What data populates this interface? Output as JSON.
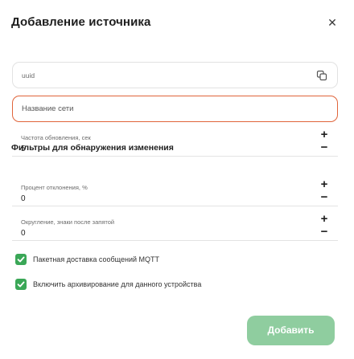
{
  "dialog": {
    "title": "Добавление источника",
    "close_icon": "close-icon"
  },
  "uuid_field": {
    "placeholder": "uuid",
    "copy_icon": "copy-icon"
  },
  "network_name_field": {
    "placeholder": "Название сети",
    "border_color": "#e0643a"
  },
  "update_frequency": {
    "label": "Частота обновления, сек",
    "value": "5",
    "plus": "+",
    "minus": "−"
  },
  "filters_section": {
    "title": "Фильтры для обнаружения изменения"
  },
  "deviation_percent": {
    "label": "Процент отклонения, %",
    "value": "0",
    "plus": "+",
    "minus": "−"
  },
  "rounding": {
    "label": "Округление, знаки после запятой",
    "value": "0",
    "plus": "+",
    "minus": "−"
  },
  "checkboxes": [
    {
      "label": "Пакетная доставка сообщений MQTT",
      "checked": true
    },
    {
      "label": "Включить архивирование для данного устройства",
      "checked": true
    }
  ],
  "submit_button": {
    "label": "Добавить",
    "color": "#8fcd9f"
  }
}
